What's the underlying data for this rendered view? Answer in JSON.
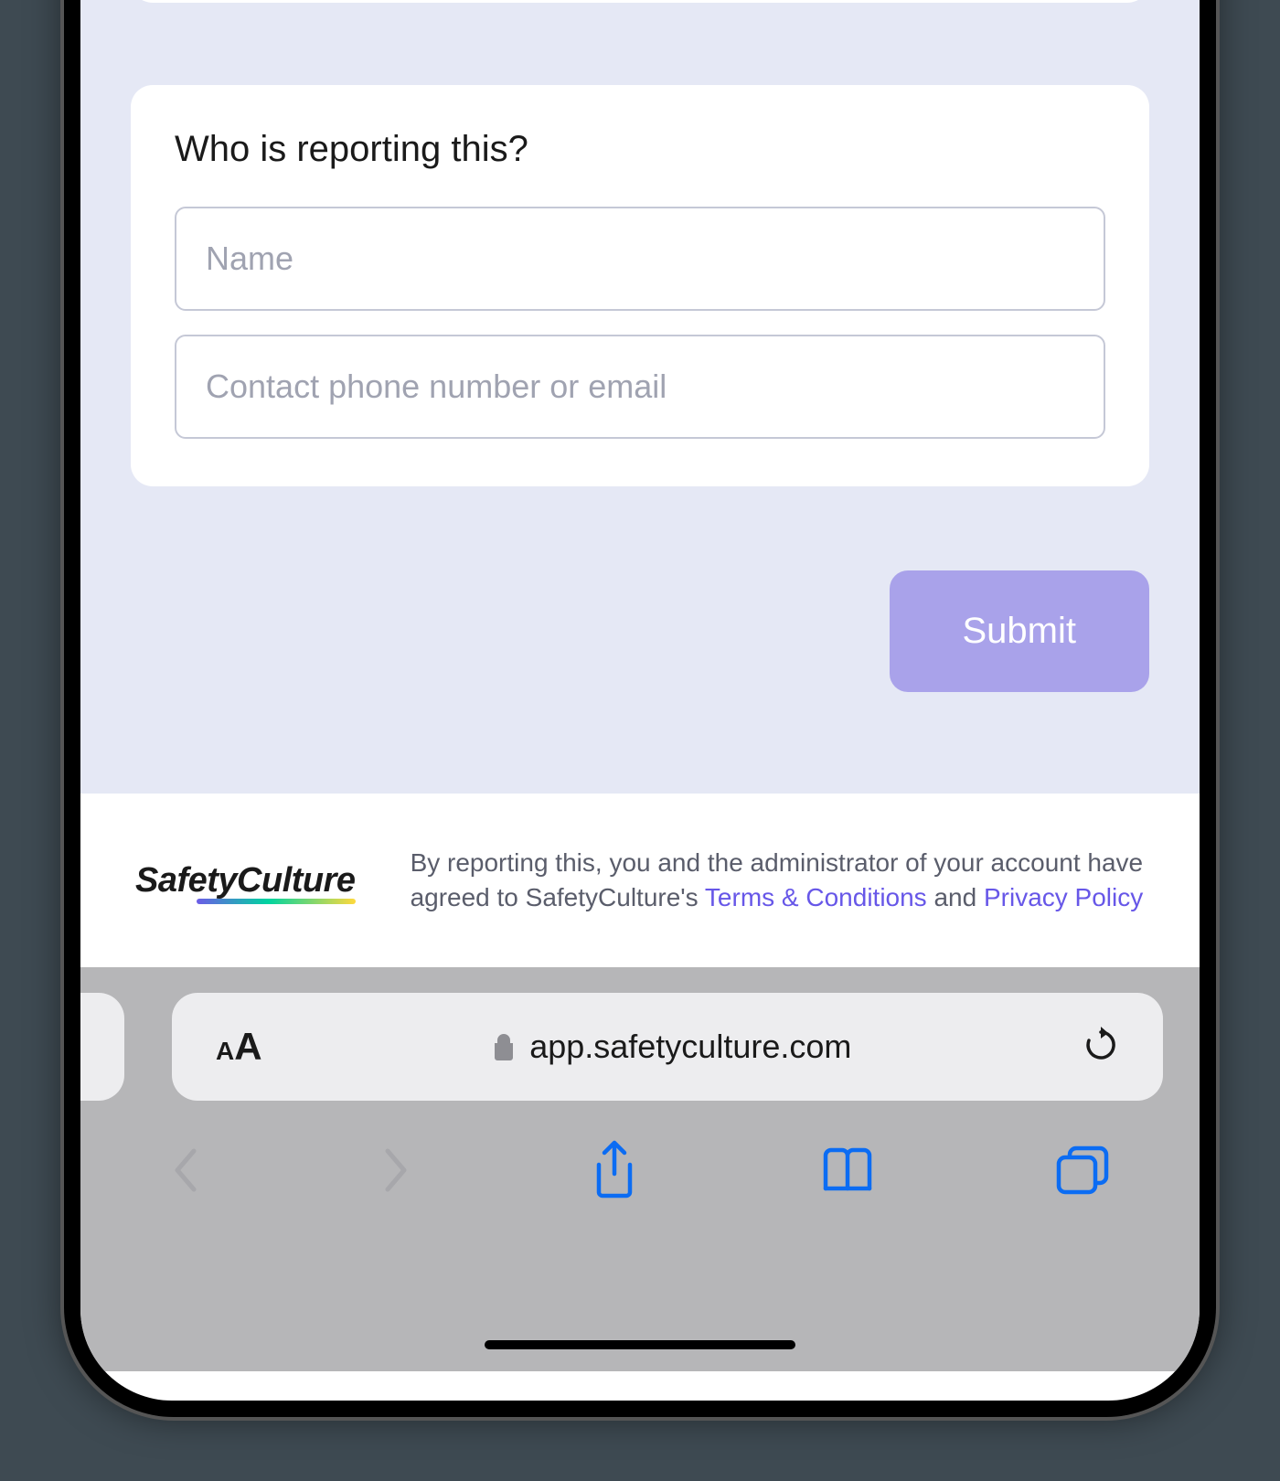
{
  "form": {
    "title": "Who is reporting this?",
    "name_placeholder": "Name",
    "contact_placeholder": "Contact phone number or email",
    "submit_label": "Submit"
  },
  "footer": {
    "logo_text": "SafetyCulture",
    "legal_prefix": "By reporting this, you and the administrator of your account have agreed to SafetyCulture's ",
    "terms_label": "Terms & Conditions",
    "legal_mid": " and ",
    "privacy_label": "Privacy Policy"
  },
  "browser": {
    "url": "app.safetyculture.com"
  }
}
